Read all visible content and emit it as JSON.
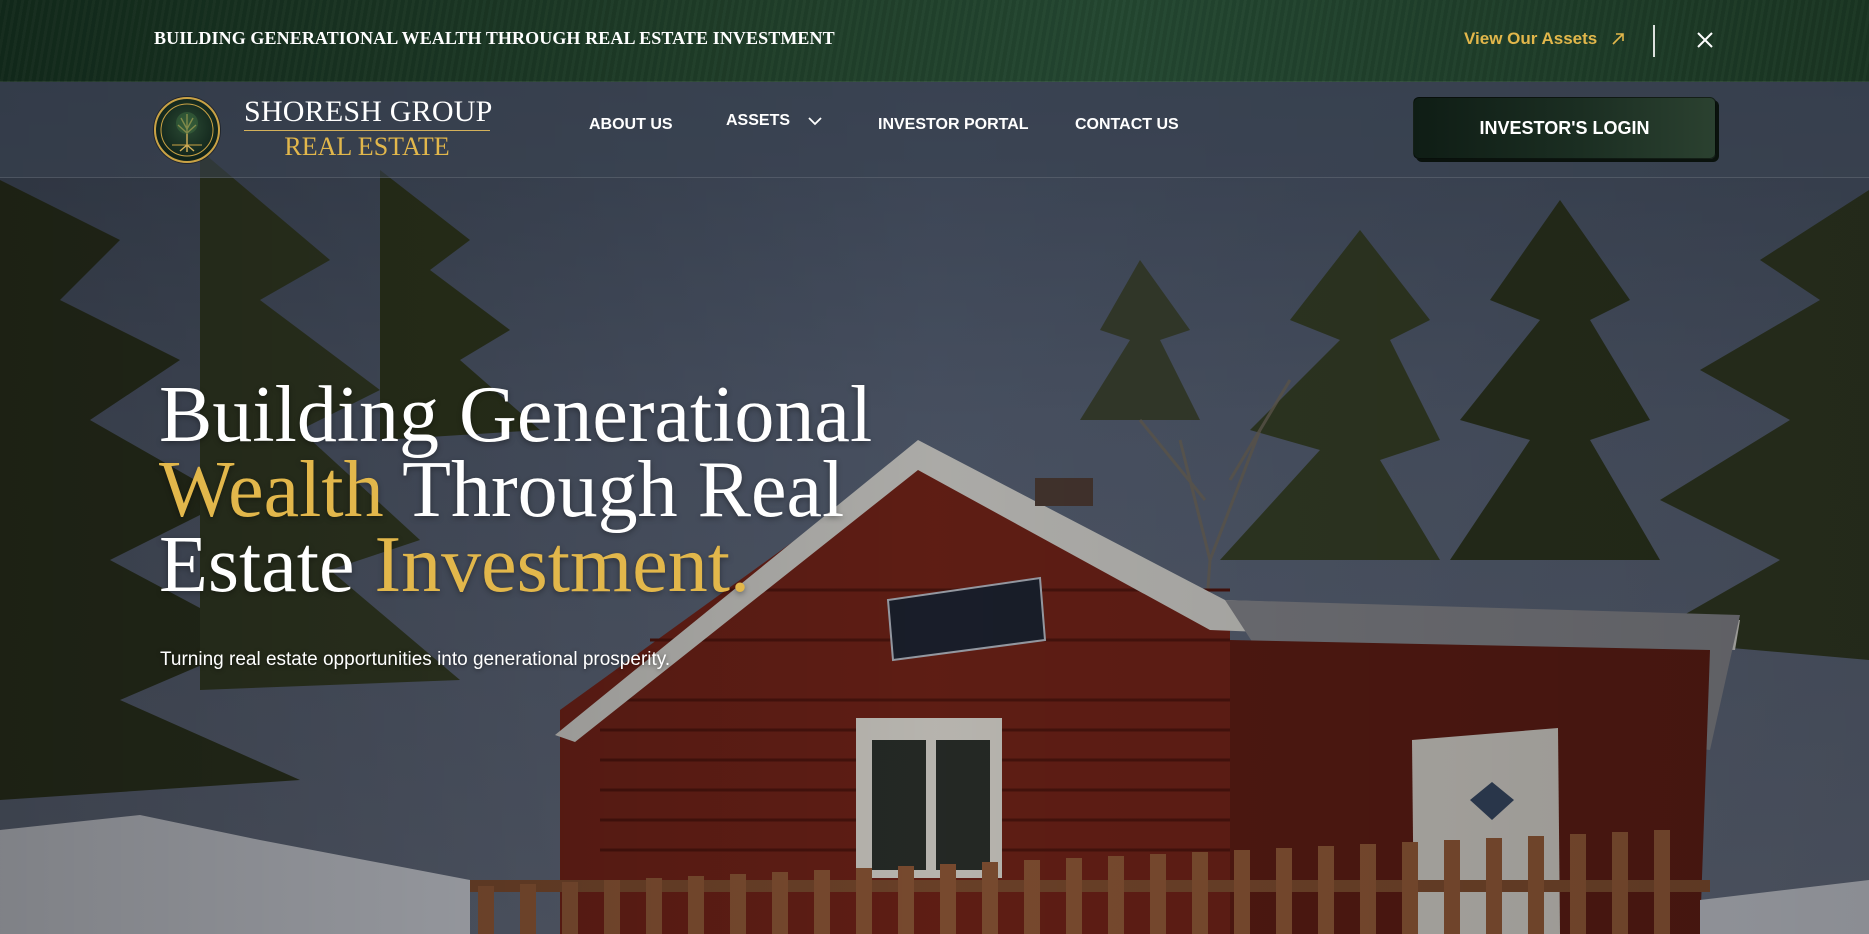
{
  "announcement": {
    "text": "BUILDING GENERATIONAL WEALTH THROUGH REAL ESTATE INVESTMENT",
    "link_label": "View Our Assets",
    "link_icon": "arrow-up-right-icon",
    "close_icon": "close-icon"
  },
  "brand": {
    "line1": "SHORESH GROUP",
    "line2": "REAL ESTATE",
    "emblem_icon": "tree-emblem-icon"
  },
  "nav": {
    "about": "ABOUT US",
    "assets": "ASSETS",
    "portal": "INVESTOR PORTAL",
    "contact": "CONTACT US"
  },
  "login": {
    "label": "INVESTOR'S LOGIN"
  },
  "hero": {
    "title_part1": "Building Generational",
    "title_part2": "Wealth",
    "title_part3": " Through Real",
    "title_part4": "Estate ",
    "title_part5": "Investment.",
    "subtitle": "Turning real estate opportunities into generational prosperity."
  },
  "colors": {
    "accent_gold": "#e2b74b",
    "banner_green": "#1f3d28",
    "login_button": "#1b2e22"
  }
}
